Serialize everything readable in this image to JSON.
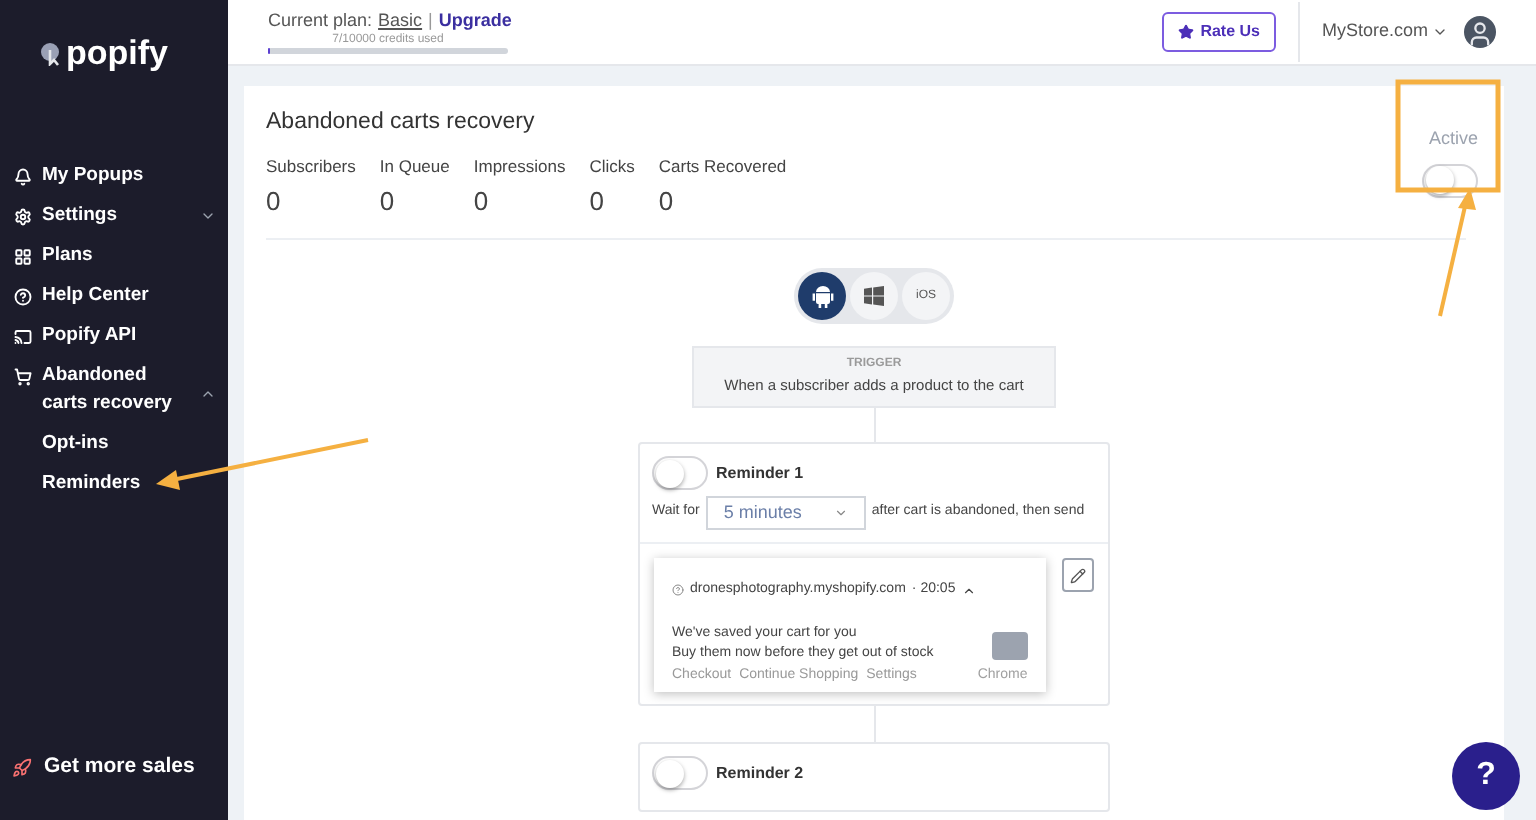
{
  "sidebar": {
    "logo": "popify",
    "items": [
      {
        "label": "My Popups",
        "selected": false
      },
      {
        "label": "Settings",
        "selected": false,
        "expanded": false
      },
      {
        "label": "Plans",
        "selected": false
      },
      {
        "label": "Help Center",
        "selected": false
      },
      {
        "label": "Popify API",
        "selected": false
      },
      {
        "label": "Abandoned carts recovery",
        "selected": false,
        "expanded": true,
        "children": [
          {
            "label": "Opt-ins",
            "selected": false
          },
          {
            "label": "Reminders",
            "selected": false
          }
        ]
      }
    ],
    "footer": "Get more sales"
  },
  "header": {
    "plan_label": "Current plan:",
    "plan_name": "Basic",
    "separator": "|",
    "upgrade": "Upgrade",
    "credits": "7/10000 credits used",
    "credits_usage": {
      "level": 0.0007
    },
    "rate_button": "Rate Us",
    "store": "MyStore.com"
  },
  "card": {
    "title": "Abandoned carts recovery",
    "active_label": "Active",
    "active": false,
    "stats": [
      {
        "label": "Subscribers",
        "value": "0"
      },
      {
        "label": "In Queue",
        "value": "0"
      },
      {
        "label": "Impressions",
        "value": "0"
      },
      {
        "label": "Clicks",
        "value": "0"
      },
      {
        "label": "Carts Recovered",
        "value": "0"
      }
    ],
    "platforms": [
      {
        "kind": "android",
        "selected": true
      },
      {
        "kind": "windows",
        "selected": false
      },
      {
        "kind": "text",
        "label": "iOS",
        "selected": false
      }
    ],
    "trigger": {
      "heading": "TRIGGER",
      "text": "When a subscriber adds a product to the cart"
    },
    "reminders": [
      {
        "title": "Reminder 1",
        "on": false,
        "wait_label": "Wait for",
        "wait_value": "5 minutes",
        "after_text": "after cart is abandoned, then send",
        "preview": {
          "site": "dronesphotography.myshopify.com",
          "time": "· 20:05",
          "title": "We've saved your cart for you",
          "body": "Buy them now before they get out of stock",
          "actions": [
            "Checkout",
            "Continue Shopping",
            "Settings"
          ],
          "browser": "Chrome"
        }
      },
      {
        "title": "Reminder 2",
        "on": false
      }
    ]
  },
  "help_button": "?"
}
